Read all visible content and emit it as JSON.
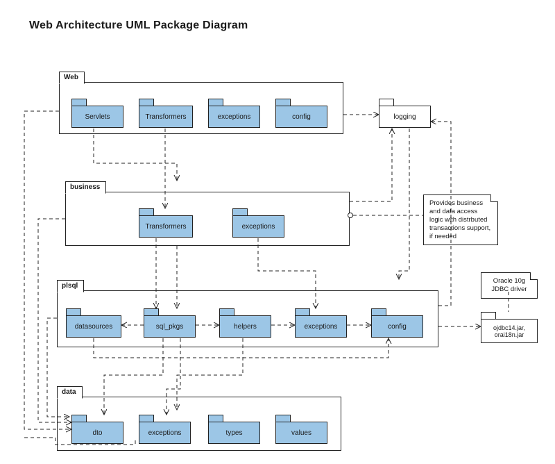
{
  "title": "Web Architecture UML Package Diagram",
  "colors": {
    "packageFill": "#9cc6e6",
    "line": "#222222"
  },
  "containers": {
    "web": {
      "label": "Web"
    },
    "business": {
      "label": "business"
    },
    "plsql": {
      "label": "plsql"
    },
    "data": {
      "label": "data"
    }
  },
  "packages": {
    "web": {
      "servlets": {
        "label": "Servlets"
      },
      "transformers": {
        "label": "Transformers"
      },
      "exceptions": {
        "label": "exceptions"
      },
      "config": {
        "label": "config"
      }
    },
    "business": {
      "transformers": {
        "label": "Transformers"
      },
      "exceptions": {
        "label": "exceptions"
      }
    },
    "plsql": {
      "datasources": {
        "label": "datasources"
      },
      "sql_pkgs": {
        "label": "sql_pkgs"
      },
      "helpers": {
        "label": "helpers"
      },
      "exceptions": {
        "label": "exceptions"
      },
      "config": {
        "label": "config"
      }
    },
    "data": {
      "dto": {
        "label": "dto"
      },
      "exceptions": {
        "label": "exceptions"
      },
      "types": {
        "label": "types"
      },
      "values": {
        "label": "values"
      }
    },
    "external": {
      "logging": {
        "label": "logging"
      },
      "jdbc": {
        "label": "ojdbc14.jar, orai18n.jar"
      }
    }
  },
  "notes": {
    "businessNote": {
      "text": "Provides business and data access logic with distrbuted transactions support, if needed"
    },
    "jdbcNote": {
      "text": "Oracle 10g JDBC driver"
    }
  },
  "dependencies": [
    {
      "from": "web.servlets",
      "to": "business"
    },
    {
      "from": "web.transformers",
      "to": "business.transformers"
    },
    {
      "from": "web",
      "to": "logging"
    },
    {
      "from": "web",
      "to": "data.dto"
    },
    {
      "from": "web",
      "to": "data.exceptions"
    },
    {
      "from": "business",
      "to": "logging"
    },
    {
      "from": "business",
      "to": "plsql.sql_pkgs"
    },
    {
      "from": "business.transformers",
      "to": "plsql.sql_pkgs"
    },
    {
      "from": "business.exceptions",
      "to": "plsql.exceptions"
    },
    {
      "from": "business",
      "to": "data.dto"
    },
    {
      "from": "plsql",
      "to": "logging"
    },
    {
      "from": "plsql.sql_pkgs",
      "to": "plsql.datasources"
    },
    {
      "from": "plsql.sql_pkgs",
      "to": "plsql.helpers"
    },
    {
      "from": "plsql.helpers",
      "to": "plsql.exceptions"
    },
    {
      "from": "plsql.exceptions",
      "to": "plsql.config"
    },
    {
      "from": "plsql.datasources",
      "to": "plsql.config"
    },
    {
      "from": "plsql.config",
      "to": "external.jdbc"
    },
    {
      "from": "plsql.sql_pkgs",
      "to": "data.dto"
    },
    {
      "from": "plsql.sql_pkgs",
      "to": "data.exceptions"
    },
    {
      "from": "plsql.helpers",
      "to": "data.exceptions"
    },
    {
      "from": "plsql",
      "to": "data.dto"
    },
    {
      "from": "note.businessNote",
      "to": "business",
      "kind": "note-anchor"
    },
    {
      "from": "note.jdbcNote",
      "to": "external.jdbc",
      "kind": "note-anchor"
    }
  ]
}
